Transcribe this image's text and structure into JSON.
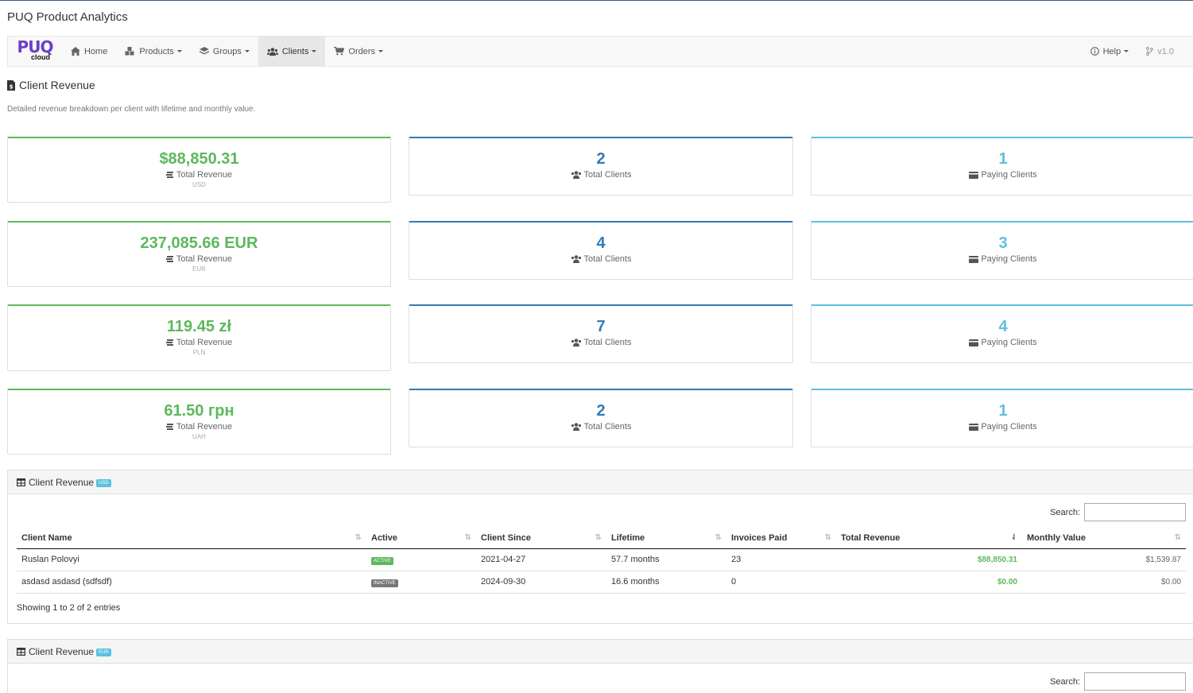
{
  "app": {
    "title": "PUQ Product Analytics"
  },
  "nav": {
    "brand_main": "PUQ",
    "brand_sub": "cloud",
    "items": [
      {
        "label": "Home",
        "icon": "home-icon",
        "dropdown": false
      },
      {
        "label": "Products",
        "icon": "cubes-icon",
        "dropdown": true
      },
      {
        "label": "Groups",
        "icon": "layers-icon",
        "dropdown": true
      },
      {
        "label": "Clients",
        "icon": "users-icon",
        "dropdown": true,
        "active": true
      },
      {
        "label": "Orders",
        "icon": "cart-icon",
        "dropdown": true
      }
    ],
    "help_label": "Help",
    "version_label": "v1.0"
  },
  "page": {
    "title": "Client Revenue",
    "description": "Detailed revenue breakdown per client with lifetime and monthly value."
  },
  "stats": [
    {
      "revenue": "$88,850.31",
      "revenue_label": "Total Revenue",
      "currency": "USD",
      "total_clients": "2",
      "total_clients_label": "Total Clients",
      "paying_clients": "1",
      "paying_clients_label": "Paying Clients"
    },
    {
      "revenue": "237,085.66 EUR",
      "revenue_label": "Total Revenue",
      "currency": "EUR",
      "total_clients": "4",
      "total_clients_label": "Total Clients",
      "paying_clients": "3",
      "paying_clients_label": "Paying Clients"
    },
    {
      "revenue": "119.45 zł",
      "revenue_label": "Total Revenue",
      "currency": "PLN",
      "total_clients": "7",
      "total_clients_label": "Total Clients",
      "paying_clients": "4",
      "paying_clients_label": "Paying Clients"
    },
    {
      "revenue": "61.50 грн",
      "revenue_label": "Total Revenue",
      "currency": "UAH",
      "total_clients": "2",
      "total_clients_label": "Total Clients",
      "paying_clients": "1",
      "paying_clients_label": "Paying Clients"
    }
  ],
  "panels": [
    {
      "title": "Client Revenue",
      "badge": "USD",
      "search_label": "Search:",
      "search_value": "",
      "columns": [
        "Client Name",
        "Active",
        "Client Since",
        "Lifetime",
        "Invoices Paid",
        "Total Revenue",
        "Monthly Value"
      ],
      "rows": [
        {
          "name": "Ruslan Polovyi",
          "status": "ACTIVE",
          "since": "2021-04-27",
          "lifetime": "57.7 months",
          "invoices": "23",
          "revenue": "$88,850.31",
          "monthly": "$1,539.87"
        },
        {
          "name": "asdasd asdasd (sdfsdf)",
          "status": "INACTIVE",
          "since": "2024-09-30",
          "lifetime": "16.6 months",
          "invoices": "0",
          "revenue": "$0.00",
          "monthly": "$0.00"
        }
      ],
      "info": "Showing 1 to 2 of 2 entries"
    },
    {
      "title": "Client Revenue",
      "badge": "EUR",
      "search_label": "Search:",
      "search_value": ""
    }
  ],
  "colors": {
    "green": "#5cb85c",
    "blue": "#337ab7",
    "cyan": "#5bc0de",
    "brand": "#6a3fc7"
  }
}
